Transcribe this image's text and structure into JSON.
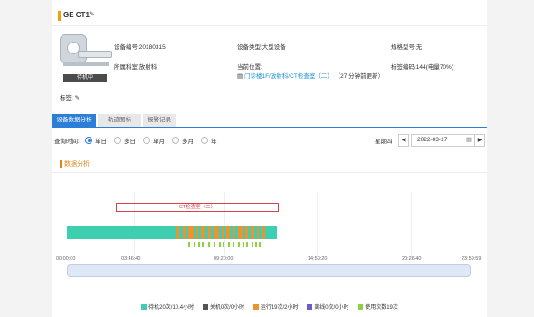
{
  "device": {
    "title": "GE CT1",
    "status": "待机中",
    "device_no": "设备编号:20180315",
    "device_type": "设备类型:大型设备",
    "spec_model": "规格型号:无",
    "department": "所属科室:放射科",
    "location_label": "当前位置:",
    "location_value": "门诊楼1F/放射科/CT检查室（二）",
    "location_updated": "（27 分钟前更新）",
    "tag_no": "标签编码:144(电量70%)",
    "tag_label": "标签:"
  },
  "tabs": [
    {
      "label": "设备数据分析",
      "active": true
    },
    {
      "label": "轨迹图标",
      "active": false
    },
    {
      "label": "报警记录",
      "active": false
    }
  ],
  "filter": {
    "label": "查询时间:",
    "options": [
      "单日",
      "多日",
      "单月",
      "多月",
      "年"
    ],
    "selected": "单日",
    "weekday": "星期四",
    "date": "2022-03-17"
  },
  "section_title": "数据分析",
  "timeline": {
    "location_bar_label": "CT检查室（二）",
    "axis_labels": [
      "00:00:00",
      "03:46:40",
      "09:20:00",
      "14:53:20",
      "20:26:40",
      "23:59:59"
    ]
  },
  "legend": [
    {
      "label": "待机20次/10.4小时",
      "color": "#3dcfb0"
    },
    {
      "label": "关机0次/0小时",
      "color": "#555555"
    },
    {
      "label": "运行19次/2小时",
      "color": "#f0922f"
    },
    {
      "label": "离线0次/0小时",
      "color": "#6a5acd"
    },
    {
      "label": "使用次数19次",
      "color": "#8fd241"
    }
  ],
  "icons": [
    "edit-icon",
    "calendar-icon",
    "prev-icon",
    "next-icon"
  ]
}
